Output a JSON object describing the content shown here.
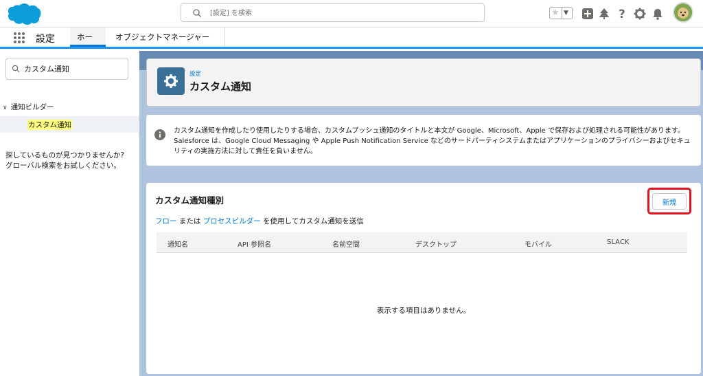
{
  "header": {
    "search_placeholder": "[設定] を検索"
  },
  "context_bar": {
    "app_name": "設定",
    "tabs": [
      {
        "label": "ホーム"
      },
      {
        "label": "オブジェクトマネージャー"
      }
    ]
  },
  "sidebar": {
    "quick_find_value": "カスタム通知",
    "tree_node": "通知ビルダー",
    "tree_leaf": "カスタム通知",
    "help_line1": "探しているものが見つかりませんか?",
    "help_line2": "グローバル検索をお試しください。"
  },
  "page_header": {
    "eyebrow": "設定",
    "title": "カスタム通知"
  },
  "notice": {
    "text": "カスタム通知を作成したり使用したりする場合、カスタムプッシュ通知のタイトルと本文が Google、Microsoft、Apple で保存および処理される可能性があります。Salesforce は、Google Cloud Messaging や Apple Push Notification Service などのサードパーティシステムまたはアプリケーションのプライバシーおよびセキュリティの実施方法に対して責任を負いません。"
  },
  "card": {
    "title": "カスタム通知種別",
    "new_button": "新規",
    "desc_link1": "フロー",
    "desc_mid": " または ",
    "desc_link2": "プロセスビルダー",
    "desc_end": " を使用してカスタム通知を送信",
    "columns": [
      "通知名",
      "API 参照名",
      "名前空間",
      "デスクトップ",
      "モバイル",
      "SLACK"
    ],
    "empty_message": "表示する項目はありません。"
  },
  "colors": {
    "brand_blue": "#0176d3",
    "highlight_red": "#e0121f",
    "page_bg": "#b0c4df"
  }
}
